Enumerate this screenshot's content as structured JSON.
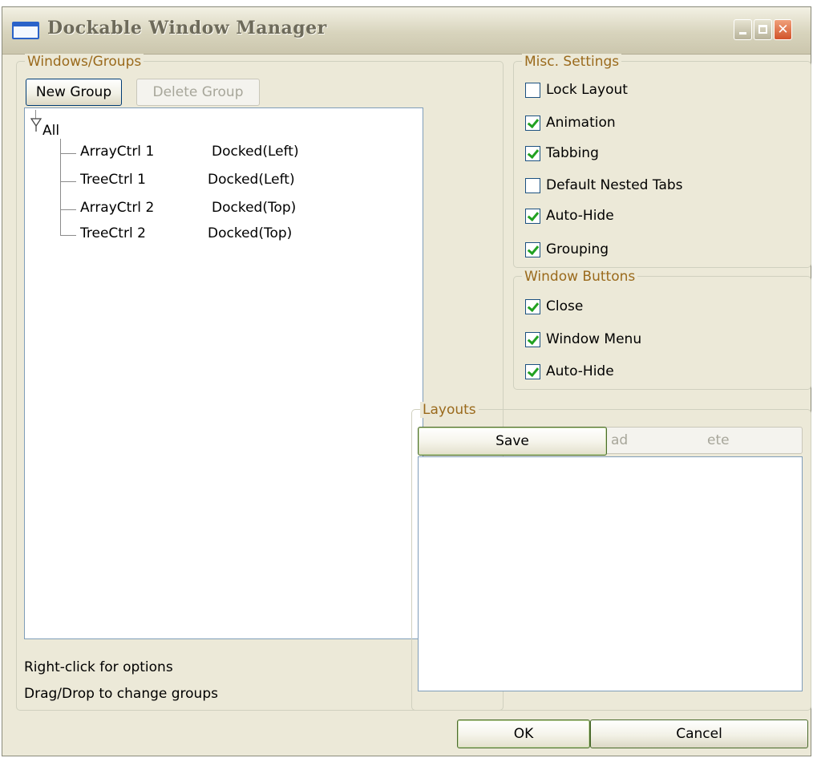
{
  "window": {
    "title": "Dockable Window Manager"
  },
  "windows_groups": {
    "legend": "Windows/Groups",
    "new_group_label": "New Group",
    "delete_group_label": "Delete Group",
    "tree": {
      "root": "All",
      "items": [
        {
          "name": "ArrayCtrl 1",
          "state": "Docked(Left)"
        },
        {
          "name": "TreeCtrl 1",
          "state": "Docked(Left)"
        },
        {
          "name": "ArrayCtrl 2",
          "state": "Docked(Top)"
        },
        {
          "name": "TreeCtrl 2",
          "state": "Docked(Top)"
        }
      ]
    },
    "hint_right_click": "Right-click for options",
    "hint_drag_drop": "Drag/Drop to change groups"
  },
  "misc_settings": {
    "legend": "Misc. Settings",
    "options": [
      {
        "label": "Lock Layout",
        "checked": false
      },
      {
        "label": "Animation",
        "checked": true
      },
      {
        "label": "Tabbing",
        "checked": true
      },
      {
        "label": "Default Nested Tabs",
        "checked": false
      },
      {
        "label": "Auto-Hide",
        "checked": true
      },
      {
        "label": "Grouping",
        "checked": true
      }
    ]
  },
  "window_buttons": {
    "legend": "Window Buttons",
    "options": [
      {
        "label": "Close",
        "checked": true
      },
      {
        "label": "Window Menu",
        "checked": true
      },
      {
        "label": "Auto-Hide",
        "checked": true
      }
    ]
  },
  "layouts": {
    "legend": "Layouts",
    "save_label": "Save",
    "load_label_visible": "ad",
    "delete_label_visible": "ete"
  },
  "footer": {
    "ok_label": "OK",
    "cancel_label": "Cancel"
  }
}
